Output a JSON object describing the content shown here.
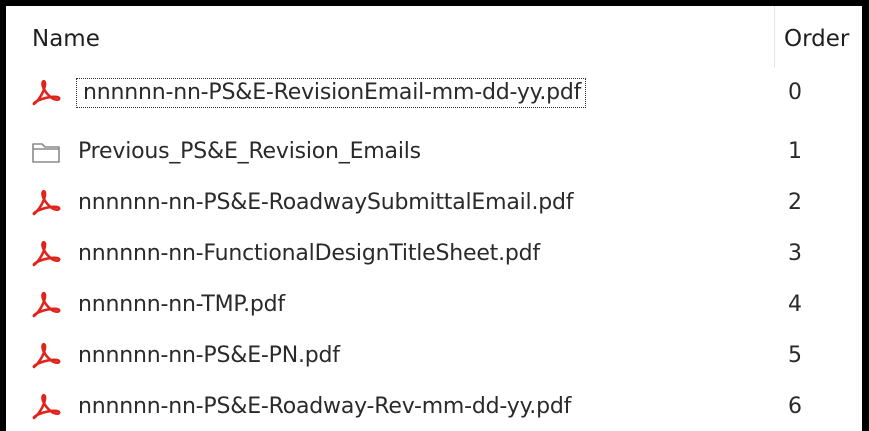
{
  "columns": {
    "name": "Name",
    "order": "Order"
  },
  "rows": [
    {
      "icon": "pdf-icon",
      "name": "nnnnnn-nn-PS&E-RevisionEmail-mm-dd-yy.pdf",
      "order": "0",
      "focused": true
    },
    {
      "icon": "folder-icon",
      "name": "Previous_PS&E_Revision_Emails",
      "order": "1",
      "focused": false
    },
    {
      "icon": "pdf-icon",
      "name": "nnnnnn-nn-PS&E-RoadwaySubmittalEmail.pdf",
      "order": "2",
      "focused": false
    },
    {
      "icon": "pdf-icon",
      "name": "nnnnnn-nn-FunctionalDesignTitleSheet.pdf",
      "order": "3",
      "focused": false
    },
    {
      "icon": "pdf-icon",
      "name": "nnnnnn-nn-TMP.pdf",
      "order": "4",
      "focused": false
    },
    {
      "icon": "pdf-icon",
      "name": "nnnnnn-nn-PS&E-PN.pdf",
      "order": "5",
      "focused": false
    },
    {
      "icon": "pdf-icon",
      "name": "nnnnnn-nn-PS&E-Roadway-Rev-mm-dd-yy.pdf",
      "order": "6",
      "focused": false
    }
  ],
  "colors": {
    "pdf_icon": "#e0231b",
    "folder_icon": "#8a8a8a",
    "frame_border": "#000000"
  }
}
